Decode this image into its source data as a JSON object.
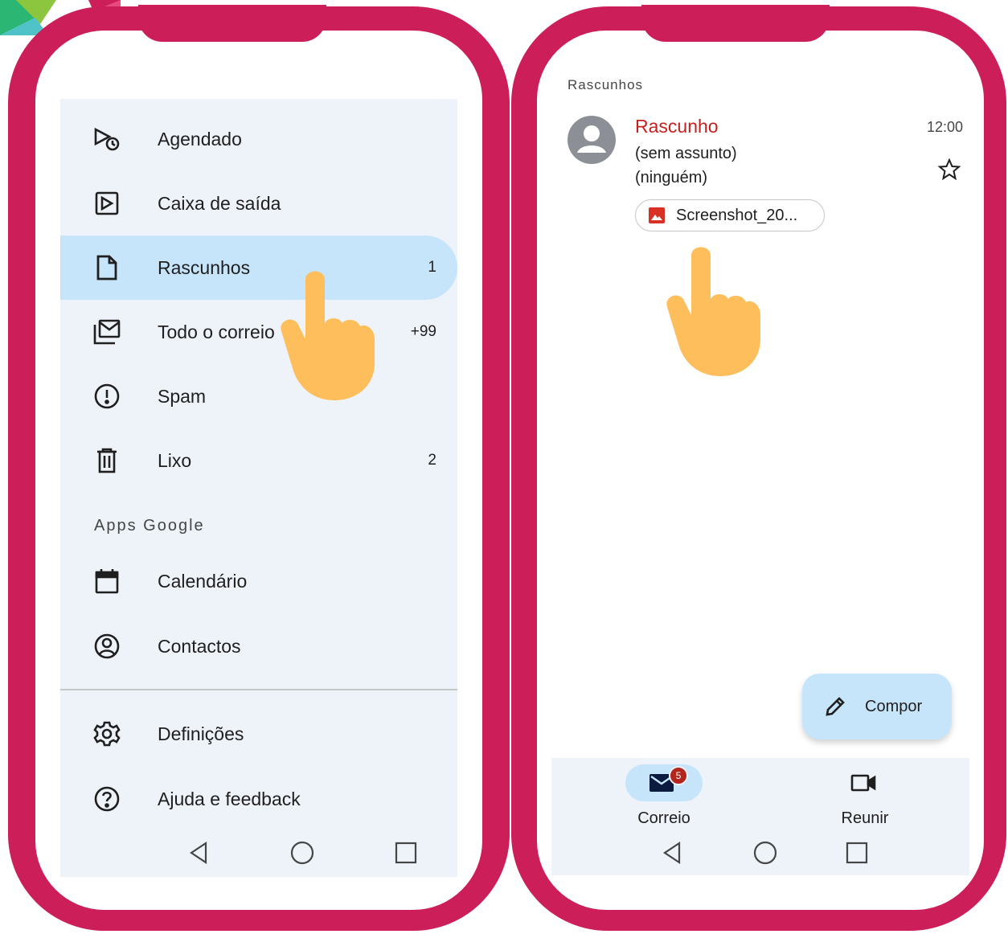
{
  "colors": {
    "frame": "#cc1f5a",
    "drawer_bg": "#eef2f9",
    "selected_bg": "#c6e5fb",
    "sender_red": "#c5221f",
    "badge_red": "#b3261e",
    "hand": "#ffbe5c"
  },
  "left_phone": {
    "menu_items": [
      {
        "label": "Agendado",
        "icon": "scheduled-send-icon",
        "count": ""
      },
      {
        "label": "Caixa de saída",
        "icon": "outbox-icon",
        "count": ""
      },
      {
        "label": "Rascunhos",
        "icon": "draft-file-icon",
        "count": "1",
        "selected": true
      },
      {
        "label": "Todo o correio",
        "icon": "all-mail-icon",
        "count": "+99"
      },
      {
        "label": "Spam",
        "icon": "report-spam-icon",
        "count": ""
      },
      {
        "label": "Lixo",
        "icon": "trash-icon",
        "count": "2"
      }
    ],
    "apps_section_title": "Apps Google",
    "apps_items": [
      {
        "label": "Calendário",
        "icon": "calendar-icon"
      },
      {
        "label": "Contactos",
        "icon": "contacts-icon"
      }
    ],
    "footer_items": [
      {
        "label": "Definições",
        "icon": "settings-gear-icon"
      },
      {
        "label": "Ajuda e feedback",
        "icon": "help-icon"
      }
    ],
    "system_nav": [
      "back-icon",
      "home-icon",
      "recents-icon"
    ]
  },
  "right_phone": {
    "list_header": "Rascunhos",
    "mail": {
      "sender": "Rascunho",
      "subject": "(sem assunto)",
      "recipients": "(ninguém)",
      "time": "12:00",
      "attachment": "Screenshot_20..."
    },
    "fab_label": "Compor",
    "bottom_nav": [
      {
        "label": "Correio",
        "icon": "mail-icon",
        "badge": "5",
        "active": true
      },
      {
        "label": "Reunir",
        "icon": "video-camera-icon",
        "active": false
      }
    ],
    "system_nav": [
      "back-icon",
      "home-icon",
      "recents-icon"
    ]
  }
}
